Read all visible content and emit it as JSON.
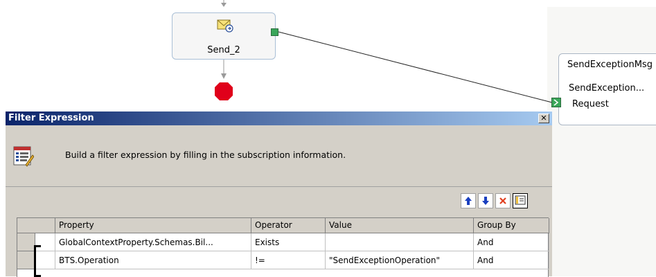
{
  "canvas": {
    "send_shape": {
      "label": "Send_2",
      "icon": "envelope-send-icon"
    },
    "port": {
      "title": "SendExceptionMsg",
      "operation": "SendException...",
      "request": "Request"
    }
  },
  "dialog": {
    "title": "Filter Expression",
    "description": "Build a filter expression by filling in the subscription information.",
    "toolbar": {
      "move_up": "up-arrow-icon",
      "move_down": "down-arrow-icon",
      "delete": "delete-x-icon",
      "toggle": "expression-view-icon"
    },
    "grid": {
      "columns": [
        "Property",
        "Operator",
        "Value",
        "Group By"
      ],
      "rows": [
        {
          "property": "GlobalContextProperty.Schemas.Bil...",
          "operator": "Exists",
          "value": "",
          "group_by": "And"
        },
        {
          "property": "BTS.Operation",
          "operator": "!=",
          "value": "\"SendExceptionOperation\"",
          "group_by": "And"
        }
      ]
    }
  },
  "colors": {
    "title_gradient_start": "#0a246a",
    "title_gradient_end": "#a6caf0",
    "dialog_face": "#d4d0c8",
    "port_green": "#3aa65a",
    "stop_red": "#e0001a"
  }
}
